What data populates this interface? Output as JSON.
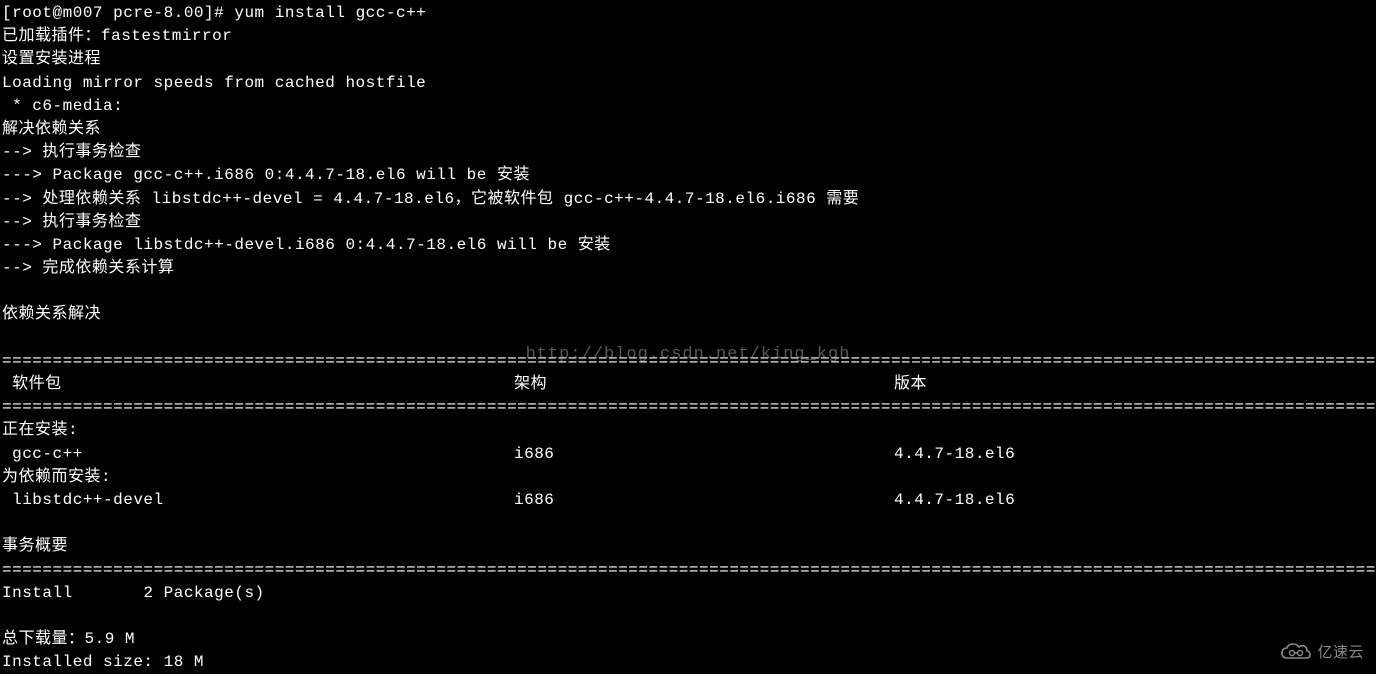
{
  "prompt": "[root@m007 pcre-8.00]# ",
  "command": "yum install gcc-c++",
  "lines": {
    "l1": "已加载插件：fastestmirror",
    "l2": "设置安装进程",
    "l3": "Loading mirror speeds from cached hostfile",
    "l4": " * c6-media:",
    "l5": "解决依赖关系",
    "l6": "--> 执行事务检查",
    "l7": "---> Package gcc-c++.i686 0:4.4.7-18.el6 will be 安装",
    "l8": "--> 处理依赖关系 libstdc++-devel = 4.4.7-18.el6，它被软件包 gcc-c++-4.4.7-18.el6.i686 需要",
    "l9": "--> 执行事务检查",
    "l10": "---> Package libstdc++-devel.i686 0:4.4.7-18.el6 will be 安装",
    "l11": "--> 完成依赖关系计算",
    "blank": " ",
    "l12": "依赖关系解决"
  },
  "separator": "==================================================================================================================================================",
  "headers": {
    "pkg": " 软件包",
    "arch": "架构",
    "version": "版本"
  },
  "installing": "正在安装:",
  "row1": {
    "pkg": " gcc-c++",
    "arch": "i686",
    "version": "4.4.7-18.el6"
  },
  "deps_installing": "为依赖而安装:",
  "row2": {
    "pkg": " libstdc++-devel",
    "arch": "i686",
    "version": "4.4.7-18.el6"
  },
  "summary_title": "事务概要",
  "install_line": "Install       2 Package(s)",
  "download_size": "总下载量：5.9 M",
  "installed_size": "Installed size: 18 M",
  "watermark": "http://blog.csdn.net/king_kgh",
  "logo_text": "亿速云"
}
